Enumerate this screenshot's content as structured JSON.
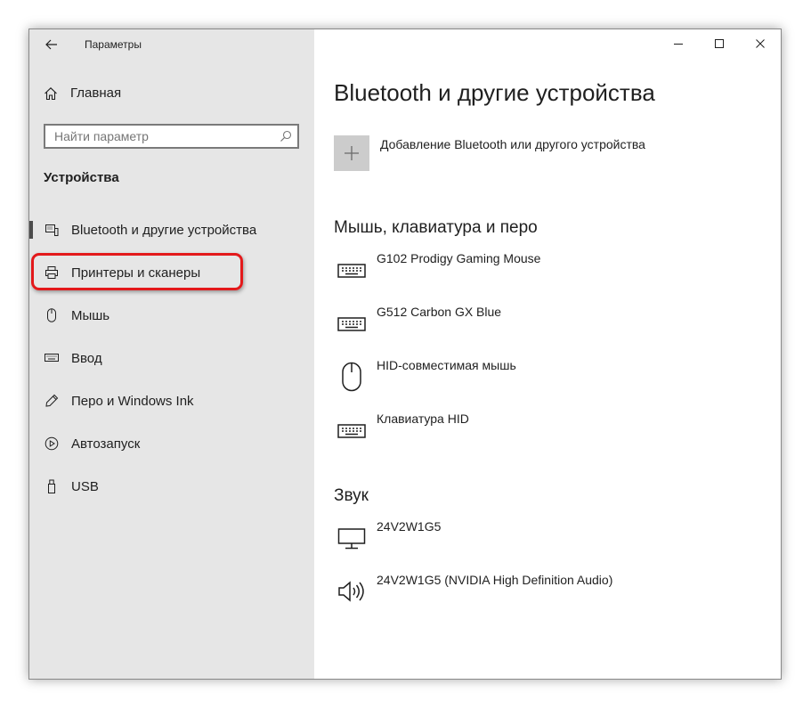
{
  "window": {
    "title": "Параметры",
    "controls": [
      "minimize-icon",
      "maximize-icon",
      "close-icon"
    ]
  },
  "sidebar": {
    "home_label": "Главная",
    "search_placeholder": "Найти параметр",
    "section_label": "Устройства",
    "items": [
      {
        "label": "Bluetooth и другие устройства",
        "icon": "bluetooth-devices-icon",
        "selected": true
      },
      {
        "label": "Принтеры и сканеры",
        "icon": "printer-icon",
        "selected": false,
        "highlighted": true
      },
      {
        "label": "Мышь",
        "icon": "mouse-icon",
        "selected": false
      },
      {
        "label": "Ввод",
        "icon": "keyboard-icon",
        "selected": false
      },
      {
        "label": "Перо и Windows Ink",
        "icon": "pen-icon",
        "selected": false
      },
      {
        "label": "Автозапуск",
        "icon": "autoplay-icon",
        "selected": false
      },
      {
        "label": "USB",
        "icon": "usb-icon",
        "selected": false
      }
    ],
    "highlight_color": "#e3191b"
  },
  "main": {
    "title": "Bluetooth и другие устройства",
    "add_device_label": "Добавление Bluetooth или другого устройства",
    "groups": [
      {
        "title": "Мышь, клавиатура и перо",
        "devices": [
          {
            "name": "G102 Prodigy Gaming Mouse",
            "icon": "keyboard-icon"
          },
          {
            "name": "G512 Carbon GX Blue",
            "icon": "keyboard-icon"
          },
          {
            "name": "HID-совместимая мышь",
            "icon": "mouse-icon"
          },
          {
            "name": "Клавиатура HID",
            "icon": "keyboard-icon"
          }
        ]
      },
      {
        "title": "Звук",
        "devices": [
          {
            "name": "24V2W1G5",
            "icon": "monitor-icon"
          },
          {
            "name": "24V2W1G5 (NVIDIA High Definition Audio)",
            "icon": "speaker-icon"
          }
        ]
      }
    ]
  },
  "colors": {
    "sidebar_bg": "#e6e6e6",
    "content_bg": "#ffffff",
    "text": "#1f1f1f",
    "add_tile_bg": "#cccccc"
  }
}
